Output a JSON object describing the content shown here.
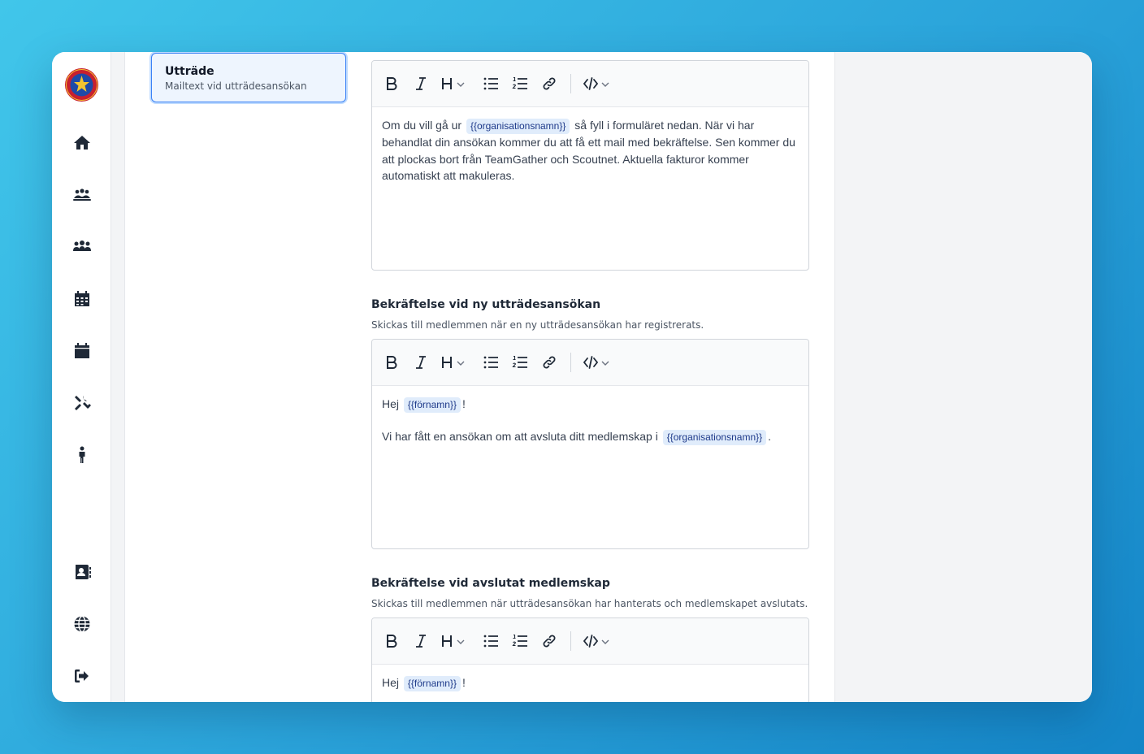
{
  "sidebar": {
    "logo": "scout-logo",
    "items": [
      {
        "icon": "home-icon"
      },
      {
        "icon": "group-meeting-icon"
      },
      {
        "icon": "members-icon"
      },
      {
        "icon": "calendar-grid-icon"
      },
      {
        "icon": "calendar-icon"
      },
      {
        "icon": "tools-icon"
      },
      {
        "icon": "person-icon"
      },
      {
        "icon": "contact-book-icon"
      },
      {
        "icon": "globe-icon"
      },
      {
        "icon": "logout-icon"
      }
    ]
  },
  "templates": {
    "selected": {
      "title": "Utträde",
      "subtitle": "Mailtext vid utträdesansökan"
    }
  },
  "editors": [
    {
      "label": "",
      "help": "",
      "body_parts": [
        "Om du vill gå ur",
        "{{organisationsnamn}}",
        "så fyll i formuläret nedan. När vi har behandlat din ansökan kommer du att få ett mail med bekräftelse. Sen kommer du att plockas bort från TeamGather och Scoutnet. Aktuella fakturor kommer automatiskt att makuleras."
      ]
    },
    {
      "label": "Bekräftelse vid ny utträdesansökan",
      "help": "Skickas till medlemmen när en ny utträdesansökan har registrerats.",
      "line1": [
        "Hej",
        "{{förnamn}}",
        "!"
      ],
      "line2": [
        "Vi har fått en ansökan om att avsluta ditt medlemskap i",
        "{{organisationsnamn}}",
        "."
      ]
    },
    {
      "label": "Bekräftelse vid avslutat medlemskap",
      "help": "Skickas till medlemmen när utträdesansökan har hanterats och medlemskapet avslutats.",
      "line1": [
        "Hej",
        "{{förnamn}}",
        "!"
      ]
    }
  ],
  "toolbar": {
    "buttons": [
      "bold-icon",
      "italic-icon",
      "heading-icon",
      "bullet-list-icon",
      "ordered-list-icon",
      "link-icon",
      "code-icon"
    ]
  },
  "colors": {
    "accent": "#3b82f6",
    "variable_bg": "#e0ecfb",
    "variable_text": "#1e3a8a"
  }
}
